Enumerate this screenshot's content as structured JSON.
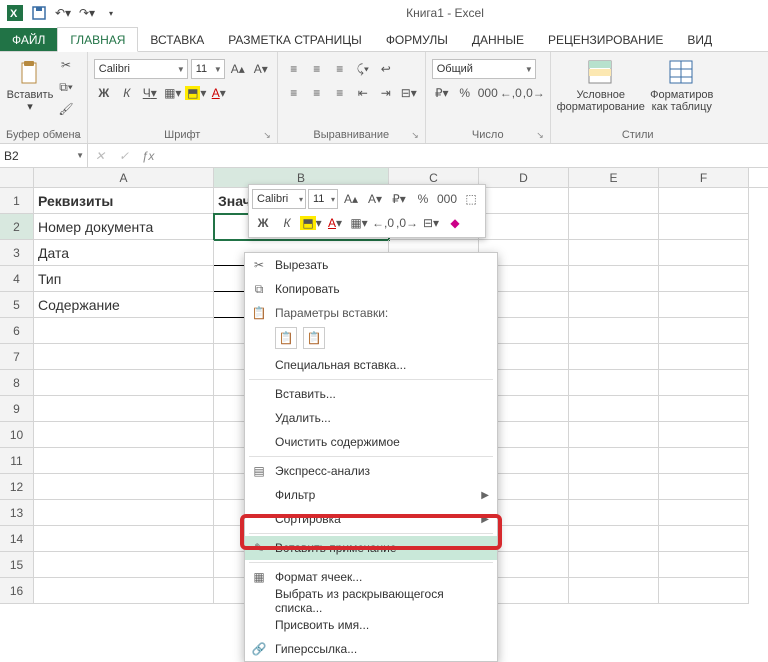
{
  "title": "Книга1 - Excel",
  "tabs": {
    "file": "ФАЙЛ",
    "items": [
      "ГЛАВНАЯ",
      "ВСТАВКА",
      "РАЗМЕТКА СТРАНИЦЫ",
      "ФОРМУЛЫ",
      "ДАННЫЕ",
      "РЕЦЕНЗИРОВАНИЕ",
      "ВИД"
    ]
  },
  "ribbon": {
    "clipboard": {
      "paste": "Вставить",
      "label": "Буфер обмена"
    },
    "font": {
      "name": "Calibri",
      "size": "11",
      "label": "Шрифт",
      "bold": "Ж",
      "italic": "К",
      "underline": "Ч"
    },
    "align": {
      "label": "Выравнивание"
    },
    "number": {
      "format": "Общий",
      "label": "Число"
    },
    "styles": {
      "cond": "Условное форматирование",
      "table": "Форматиров как таблицу",
      "label": "Стили"
    }
  },
  "namebox": "B2",
  "columns": [
    "A",
    "B",
    "C",
    "D",
    "E",
    "F"
  ],
  "grid": {
    "rows": [
      {
        "n": "1",
        "A": "Реквизиты",
        "B": "Знач",
        "bold": true
      },
      {
        "n": "2",
        "A": "Номер документа"
      },
      {
        "n": "3",
        "A": "Дата"
      },
      {
        "n": "4",
        "A": "Тип"
      },
      {
        "n": "5",
        "A": "Содержание"
      },
      {
        "n": "6"
      },
      {
        "n": "7"
      },
      {
        "n": "8"
      },
      {
        "n": "9"
      },
      {
        "n": "10"
      },
      {
        "n": "11"
      },
      {
        "n": "12"
      },
      {
        "n": "13"
      },
      {
        "n": "14"
      },
      {
        "n": "15"
      },
      {
        "n": "16"
      }
    ]
  },
  "minitb": {
    "font": "Calibri",
    "size": "11",
    "bold": "Ж",
    "italic": "К"
  },
  "ctx": {
    "cut": "Вырезать",
    "copy": "Копировать",
    "pasteLabel": "Параметры вставки:",
    "pasteSpecial": "Специальная вставка...",
    "insert": "Вставить...",
    "delete": "Удалить...",
    "clear": "Очистить содержимое",
    "quick": "Экспресс-анализ",
    "filter": "Фильтр",
    "sort": "Сортировка",
    "comment": "Вставить примечание",
    "format": "Формат ячеек...",
    "dropdown": "Выбрать из раскрывающегося списка...",
    "name": "Присвоить имя...",
    "link": "Гиперссылка..."
  }
}
